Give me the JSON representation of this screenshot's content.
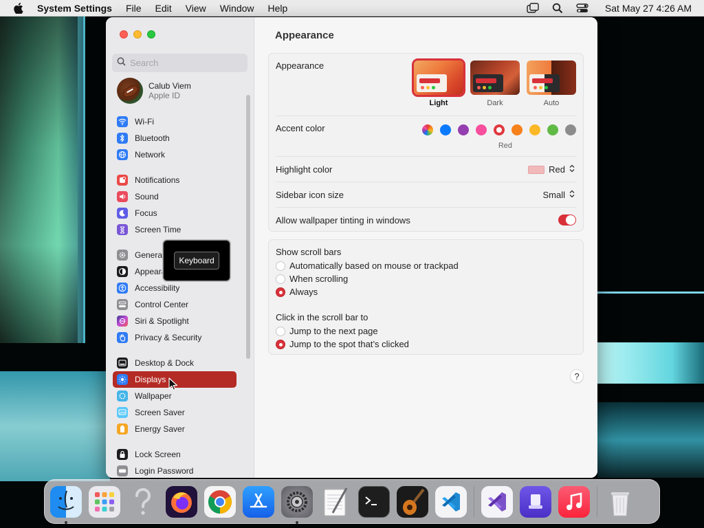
{
  "menubar": {
    "app_name": "System Settings",
    "menus": [
      "File",
      "Edit",
      "View",
      "Window",
      "Help"
    ],
    "clock": "Sat May 27  4:26 AM"
  },
  "sidebar": {
    "search_placeholder": "Search",
    "account": {
      "name": "Calub Viem",
      "subtitle": "Apple ID"
    },
    "items": [
      {
        "label": "Wi-Fi",
        "icon": "wifi-icon",
        "color": "#2f7bf5"
      },
      {
        "label": "Bluetooth",
        "icon": "bluetooth-icon",
        "color": "#2f7bf5"
      },
      {
        "label": "Network",
        "icon": "globe-icon",
        "color": "#2f7bf5"
      },
      {
        "label": "Notifications",
        "icon": "bell-icon",
        "color": "#ea4a48"
      },
      {
        "label": "Sound",
        "icon": "speaker-icon",
        "color": "#ea4a5e"
      },
      {
        "label": "Focus",
        "icon": "moon-icon",
        "color": "#5e5ce6"
      },
      {
        "label": "Screen Time",
        "icon": "hourglass-icon",
        "color": "#7a56d6"
      },
      {
        "label": "General",
        "icon": "gear-icon",
        "color": "#8e8e93"
      },
      {
        "label": "Appearance",
        "icon": "appearance-icon",
        "color": "#1c1c1e"
      },
      {
        "label": "Accessibility",
        "icon": "accessibility-icon",
        "color": "#2f7bf5"
      },
      {
        "label": "Control Center",
        "icon": "control-center-icon",
        "color": "#8e8e93"
      },
      {
        "label": "Siri & Spotlight",
        "icon": "siri-icon",
        "color": "#c04bd6"
      },
      {
        "label": "Privacy & Security",
        "icon": "hand-icon",
        "color": "#2f7bf5"
      },
      {
        "label": "Desktop & Dock",
        "icon": "dock-icon",
        "color": "#1c1c1e"
      },
      {
        "label": "Displays",
        "icon": "sun-icon",
        "color": "#2f7bf5"
      },
      {
        "label": "Wallpaper",
        "icon": "wallpaper-icon",
        "color": "#45b5e8"
      },
      {
        "label": "Screen Saver",
        "icon": "screensaver-icon",
        "color": "#5ac8fa"
      },
      {
        "label": "Energy Saver",
        "icon": "battery-icon",
        "color": "#f5a623"
      },
      {
        "label": "Lock Screen",
        "icon": "lock-icon",
        "color": "#1c1c1e"
      },
      {
        "label": "Login Password",
        "icon": "password-icon",
        "color": "#8e8e93"
      }
    ],
    "selected": "Displays",
    "tooltip": "Keyboard"
  },
  "main": {
    "title": "Appearance",
    "appearance": {
      "label": "Appearance",
      "options": [
        "Light",
        "Dark",
        "Auto"
      ],
      "selected": "Light"
    },
    "accent": {
      "label": "Accent color",
      "colors": [
        "multicolor",
        "#0a7aff",
        "#953eaf",
        "#f74f9e",
        "#e0383e",
        "#f7821b",
        "#fcb827",
        "#62ba46",
        "#8c8c8c"
      ],
      "selected_name": "Red"
    },
    "highlight": {
      "label": "Highlight color",
      "value": "Red"
    },
    "icon_size": {
      "label": "Sidebar icon size",
      "value": "Small"
    },
    "tinting": {
      "label": "Allow wallpaper tinting in windows",
      "enabled": true
    },
    "scroll_bars": {
      "label": "Show scroll bars",
      "options": [
        "Automatically based on mouse or trackpad",
        "When scrolling",
        "Always"
      ],
      "selected": "Always"
    },
    "click_scroll": {
      "label": "Click in the scroll bar to",
      "options": [
        "Jump to the next page",
        "Jump to the spot that’s clicked"
      ],
      "selected": "Jump to the spot that’s clicked"
    },
    "help": "?"
  },
  "dock": {
    "apps": [
      "Finder",
      "Launchpad",
      "Help",
      "Firefox",
      "Chrome",
      "App Store",
      "System Settings",
      "TextEdit",
      "Terminal",
      "GarageBand",
      "Visual Studio Code",
      "Visual Studio",
      "Apple Configurator",
      "Music",
      "Trash"
    ]
  },
  "colors": {
    "accent": "#d8313a",
    "selected_sidebar": "#b42b25"
  }
}
